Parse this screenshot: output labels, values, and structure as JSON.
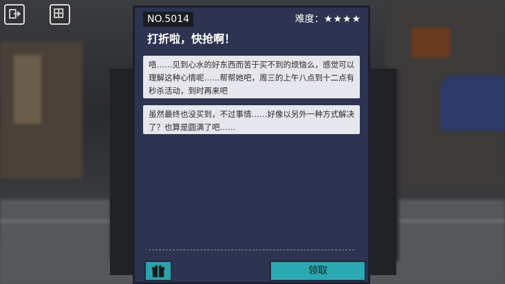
{
  "quest": {
    "number": "NO.5014",
    "difficulty_label": "难度：",
    "difficulty_stars": "★★★★",
    "difficulty_value": 4,
    "title": "打折啦，快抢啊！",
    "description": "唔……见到心水的好东西而苦于买不到的烦恼么，感觉可以理解这种心情呢……帮帮她吧，周三的上午八点到十二点有秒杀活动，到时再来吧",
    "result": "虽然最终也没买到，不过事情……好像以另外一种方式解决了？也算是圆满了吧……",
    "claim_label": "领取"
  },
  "icons": {
    "gift": "gift-icon",
    "hud_left": "exit-icon",
    "hud_right": "grid-icon"
  },
  "colors": {
    "panel_bg": "#2d3350",
    "text_box_bg": "#e6e7ed",
    "button_accent": "#2aa9b2"
  }
}
